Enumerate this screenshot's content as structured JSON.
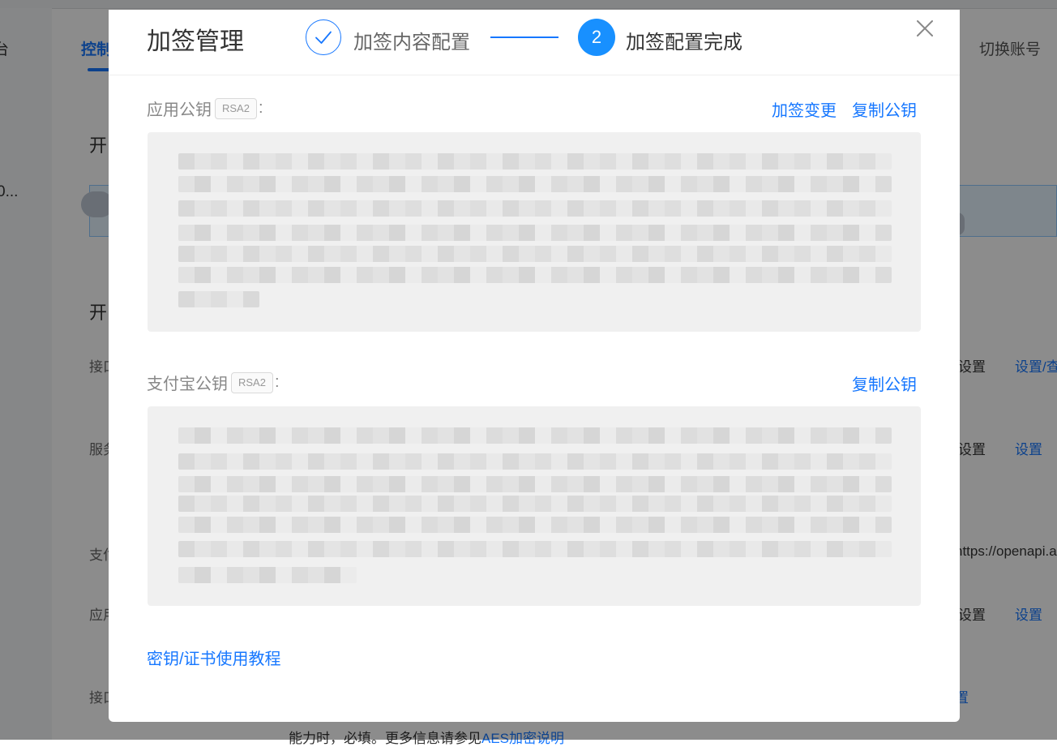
{
  "background": {
    "sidebar_char": "台",
    "sidebar_item": "0...",
    "tab_active": "控制",
    "switch_account": "切换账号",
    "section_1": "开",
    "section_2": "开",
    "row_labels": [
      "接口",
      "服务",
      "支付",
      "应用",
      "接口"
    ],
    "right_texts": [
      "设置",
      "设置",
      "设置"
    ],
    "right_links": [
      "设置/查",
      "设置",
      "设置",
      "置"
    ],
    "gateway_url": "https://openapi.al",
    "footer_text": "能力时，必填。更多信息请参见",
    "footer_link": "AES加密说明"
  },
  "modal": {
    "title": "加签管理",
    "steps": [
      {
        "label": "加签内容配置",
        "status": "done"
      },
      {
        "label": "加签配置完成",
        "number": "2",
        "status": "current"
      }
    ],
    "app_public_key": {
      "label": "应用公钥",
      "badge": "RSA2",
      "colon": ":",
      "actions": [
        "加签变更",
        "复制公钥"
      ]
    },
    "alipay_public_key": {
      "label": "支付宝公钥",
      "badge": "RSA2",
      "colon": ":",
      "actions": [
        "复制公钥"
      ]
    },
    "tutorial_link": "密钥/证书使用教程"
  },
  "colors": {
    "primary": "#1677ff",
    "step_current": "#1890ff",
    "key_box_bg": "#f0f0f0",
    "mask": "rgba(0,0,0,0.45)"
  },
  "icons": {
    "step_done": "check-icon",
    "close": "close-icon"
  }
}
